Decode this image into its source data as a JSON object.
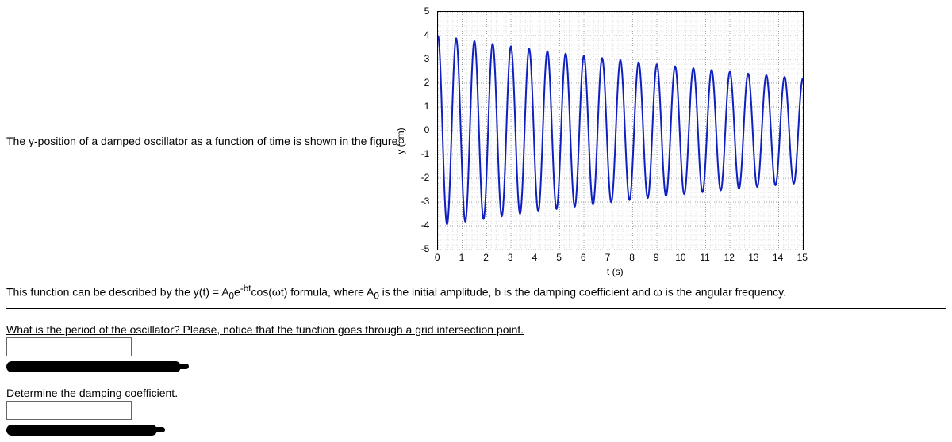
{
  "intro": "The y-position of a damped oscillator as a function of time is shown in the figure.",
  "desc_before": "This function can be described by the y(t) = A",
  "desc_sub1": "0",
  "desc_mid1": "e",
  "desc_sup": "-bt",
  "desc_mid2": "cos(ωt) formula, where A",
  "desc_sub2": "0",
  "desc_after": " is the initial amplitude, b is the damping coefficient and ω is the angular frequency.",
  "q1": "What is the period of the oscillator? Please, notice that the function goes through a grid intersection point.",
  "q2": "Determine the damping coefficient.",
  "chart": {
    "y_label": "y (cm)",
    "x_label": "t (s)",
    "y_ticks": [
      "5",
      "4",
      "3",
      "2",
      "1",
      "0",
      "-1",
      "-2",
      "-3",
      "-4",
      "-5"
    ],
    "x_ticks": [
      "0",
      "1",
      "2",
      "3",
      "4",
      "5",
      "6",
      "7",
      "8",
      "9",
      "10",
      "11",
      "12",
      "13",
      "14",
      "15"
    ]
  },
  "chart_data": {
    "type": "line",
    "title": "",
    "xlabel": "t (s)",
    "ylabel": "y (cm)",
    "xlim": [
      0,
      15
    ],
    "ylim": [
      -5,
      5
    ],
    "params": {
      "A0": 4,
      "b": 0.04,
      "omega": 8.3776,
      "period": 0.75
    },
    "note": "y(t) = A0 * exp(-b*t) * cos(omega*t); curve passes through grid intersection (7.5, 3)"
  }
}
